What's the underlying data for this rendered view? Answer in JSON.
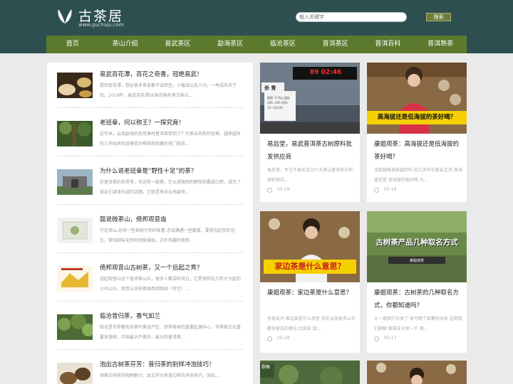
{
  "header": {
    "logo_text": "古茶居",
    "logo_sub": "www.guchaju.com",
    "search_placeholder": "输入关键字",
    "search_button": "搜索"
  },
  "nav": [
    "首页",
    "茶山介绍",
    "易武茶区",
    "勐海茶区",
    "临沧茶区",
    "普洱茶区",
    "普洱百科",
    "普洱熟茶"
  ],
  "articles": [
    {
      "title": "易武百花潭，百花之奇香，冠绝易武！",
      "desc": "提到百花潭，想必很多茶友都不会陌生，十载深山无人问，一举成名天下知，2019年，易武百花潭26米的高杆茶王树以..."
    },
    {
      "title": "老班章，何以称王？一探究竟！",
      "desc": "近年来，云南勐海的老班章村普洱茶受到了广大茶友的热烈追捧，越来越多的人开始将老班章视为喝茶和收藏的热门选择..."
    },
    {
      "title": "为什么说老班章是“野性十足”的茶？",
      "desc": "在普洱茶的世界里，有这样一款茶，它以其独特的野性和霸道口感，成为了茶友们津津乐道的话题。它就是来自云南勐海..."
    },
    {
      "title": "懿说微茶山，倚邦观音庙",
      "desc": "行走茶山,总有一些茶碗引你的味蕾,亦或偶遇一些趣事，要我勾起你的记忆，譬如田味无穷的团级曼松。古朴有趣的倚邦..."
    },
    {
      "title": "倚邦观音山古树茶，又一个后起之秀？",
      "desc": "说起观音山这个普洱茶山头，很多人都没听说过，它是倚邦这几年才兴起的小众山头。观音山古树茶由西双版纳（可空）..."
    },
    {
      "title": "临沧昔归茶，香气如兰",
      "desc": "临沧是世界著名的茶叶黄金产区、世界茶树的重要起源中心、世界茶文化重要发源地、中国最大产茶市，最大的普洱茶..."
    },
    {
      "title": "泡出古树茶芬芳：普归茶的别样冲泡技巧！",
      "desc": "探索古树茶的独特魅力，本文将分享普归茶的冲泡技巧，泡出..."
    }
  ],
  "cards": [
    {
      "title": "易后堂，易武普洱茶古树原料批发供应商",
      "desc": "易后堂，专注于易武及古六大茶山普洱茶古树原料供应。",
      "date": "05-18",
      "img_text": {
        "clock": "89 02:46",
        "sign": "杀 青",
        "board": "重量: 2.5kg  温度: 285~305  时间: 15~25分钟"
      }
    },
    {
      "title": "康姐观茶：高海拔还是低海拔的茶好喝？",
      "desc": "海拔越高茶质越好吗 前几天有位茶友交流 高海拔还是 低海拔的茶好喝 大...",
      "date": "05-18",
      "img_text": {
        "overlay": "高海拔还是低海拔的茶好喝？"
      }
    },
    {
      "title": "康姐观茶：家边茶是什么意思？",
      "desc": "有茶友问 家边茶是什么意思 其实云南很多山头 都有家边的概念 比如说 刮...",
      "date": "05-18",
      "img_text": {
        "overlay": "家边茶是什么意思？"
      }
    },
    {
      "title": "康姐观茶：古树茶的几种取名方式，你都知道吗？",
      "desc": "上一期我们分享了 背弓野丁家寨的关系 这期我们聊聊 跟茶友分享一下 普...",
      "date": "05-17",
      "img_text": {
        "overlay": "古树茶产品几种取名方式",
        "tag": "康姐观茶"
      }
    },
    {
      "title": "",
      "desc": "",
      "date": "",
      "img_text": {
        "tag": "歌喉"
      }
    },
    {
      "title": "",
      "desc": "",
      "date": "",
      "img_text": {}
    }
  ],
  "colors": {
    "header_bg": "#2e4f4f",
    "nav_bg": "#5b7a2e",
    "button_bg": "#6d7e3b",
    "overlay_yellow": "#f5d000"
  }
}
